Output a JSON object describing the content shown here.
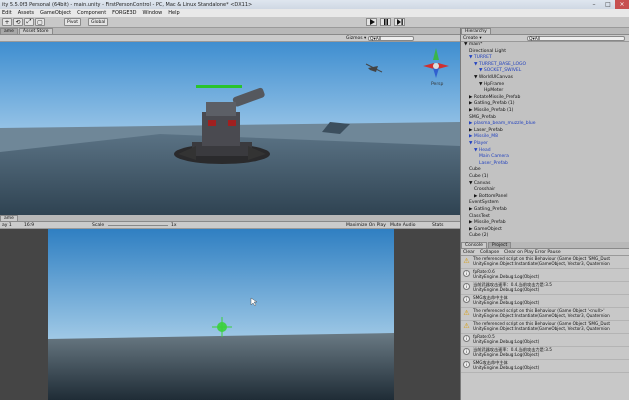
{
  "window": {
    "title": "ity 5.5.0f3 Personal (64bit) - main.unity - FirstPersonControl - PC, Mac & Linux Standalone* <DX11>"
  },
  "menu": [
    "Edit",
    "Assets",
    "GameObject",
    "Component",
    "FORGE3D",
    "Window",
    "Help"
  ],
  "toolbar": {
    "tools": [
      "+",
      "⟲",
      "⤢",
      "▢"
    ],
    "pivot_label": "Pivot",
    "global_label": "Global"
  },
  "scene_view": {
    "tab_left": "ame",
    "tab_asset_store": "Asset Store",
    "gizmos_label": "Gizmos ▾",
    "search_placeholder": "Q▾All",
    "persp_label": "Persp",
    "health_bar_fill": 1.0
  },
  "game_view": {
    "tab_label": "ame",
    "display_label": "ay 1",
    "aspect_label": "16:9",
    "scale_label": "Scale",
    "scale_value": "1x",
    "maximize_label": "Maximize On Play",
    "mute_label": "Mute Audio",
    "stats_label": "Stats"
  },
  "hierarchy": {
    "tab_label": "Hierarchy",
    "create_label": "Create ▾",
    "search_placeholder": "Q▾All",
    "items": [
      {
        "label": "▼ main*",
        "indent": 0,
        "blue": false
      },
      {
        "label": "Directional Light",
        "indent": 1,
        "blue": false
      },
      {
        "label": "▼ TURRET",
        "indent": 1,
        "blue": true
      },
      {
        "label": "▼ TURRET_BASE_LOGO",
        "indent": 2,
        "blue": true
      },
      {
        "label": "▼ SOCKET_SWIVEL",
        "indent": 3,
        "blue": true
      },
      {
        "label": "▼ WorldUICanvas",
        "indent": 2,
        "blue": false
      },
      {
        "label": "▼ HpFrame",
        "indent": 3,
        "blue": false
      },
      {
        "label": "HpMeter",
        "indent": 4,
        "blue": false
      },
      {
        "label": "▶ RotateMissile_Prefab",
        "indent": 1,
        "blue": false
      },
      {
        "label": "▶ Gatling_Prefab (1)",
        "indent": 1,
        "blue": false
      },
      {
        "label": "▶ Missile_Prefab (1)",
        "indent": 1,
        "blue": false
      },
      {
        "label": "SMG_Prefab",
        "indent": 1,
        "blue": false
      },
      {
        "label": "▶ plasma_beam_muzzle_blue",
        "indent": 1,
        "blue": true
      },
      {
        "label": "▶ Laser_Prefab",
        "indent": 1,
        "blue": false
      },
      {
        "label": "▶ Missile_M8",
        "indent": 1,
        "blue": true
      },
      {
        "label": "▼ Player",
        "indent": 1,
        "blue": true
      },
      {
        "label": "▼ Head",
        "indent": 2,
        "blue": true
      },
      {
        "label": "Main Camera",
        "indent": 3,
        "blue": true
      },
      {
        "label": "Laser_Prefab",
        "indent": 3,
        "blue": true
      },
      {
        "label": "Cube",
        "indent": 1,
        "blue": false
      },
      {
        "label": "Cube (1)",
        "indent": 1,
        "blue": false
      },
      {
        "label": "▼ Canvas",
        "indent": 1,
        "blue": false
      },
      {
        "label": "Crosshair",
        "indent": 2,
        "blue": false
      },
      {
        "label": "▶ BottomPanel",
        "indent": 2,
        "blue": false
      },
      {
        "label": "EventSystem",
        "indent": 1,
        "blue": false
      },
      {
        "label": "▶ Gatling_Prefab",
        "indent": 1,
        "blue": false
      },
      {
        "label": "ClassText",
        "indent": 1,
        "blue": false
      },
      {
        "label": "▶ Missile_Prefab",
        "indent": 1,
        "blue": false
      },
      {
        "label": "▶ GameObject",
        "indent": 1,
        "blue": false
      },
      {
        "label": "Cube (2)",
        "indent": 1,
        "blue": false
      }
    ]
  },
  "console": {
    "tab_console": "Console",
    "tab_project": "Project",
    "clear_label": "Clear",
    "collapse_label": "Collapse",
    "clear_on_play_label": "Clear on Play",
    "error_pause_label": "Error Pause",
    "logs": [
      {
        "type": "warn",
        "line1": "The referenced script on this Behaviour (Game Object 'SMG_Dust",
        "line2": "UnityEngine.Object:Instantiate(GameObject, Vector3, Quaternion"
      },
      {
        "type": "info",
        "line1": "fpRate:0.6",
        "line2": "UnityEngine.Debug:Log(Object)"
      },
      {
        "type": "info",
        "line1": "当前武器攻击速率：0.4,当前攻击力是:3.5",
        "line2": "UnityEngine.Debug:Log(Object)"
      },
      {
        "type": "info",
        "line1": "SMG攻击命中主体",
        "line2": "UnityEngine.Debug:Log(Object)"
      },
      {
        "type": "warn",
        "line1": "The referenced script on this Behaviour (Game Object '<null>'",
        "line2": "UnityEngine.Object:Instantiate(GameObject, Vector3, Quaternion"
      },
      {
        "type": "warn",
        "line1": "The referenced script on this Behaviour (Game Object 'SMG_Dust",
        "line2": "UnityEngine.Object:Instantiate(GameObject, Vector3, Quaternion"
      },
      {
        "type": "info",
        "line1": "fpRate:0.5",
        "line2": "UnityEngine.Debug:Log(Object)"
      },
      {
        "type": "info",
        "line1": "当前武器攻击速率：0.4,当前攻击力是:3.5",
        "line2": "UnityEngine.Debug:Log(Object)"
      },
      {
        "type": "info",
        "line1": "SMG攻击命中主体",
        "line2": "UnityEngine.Debug:Log(Object)"
      }
    ]
  }
}
